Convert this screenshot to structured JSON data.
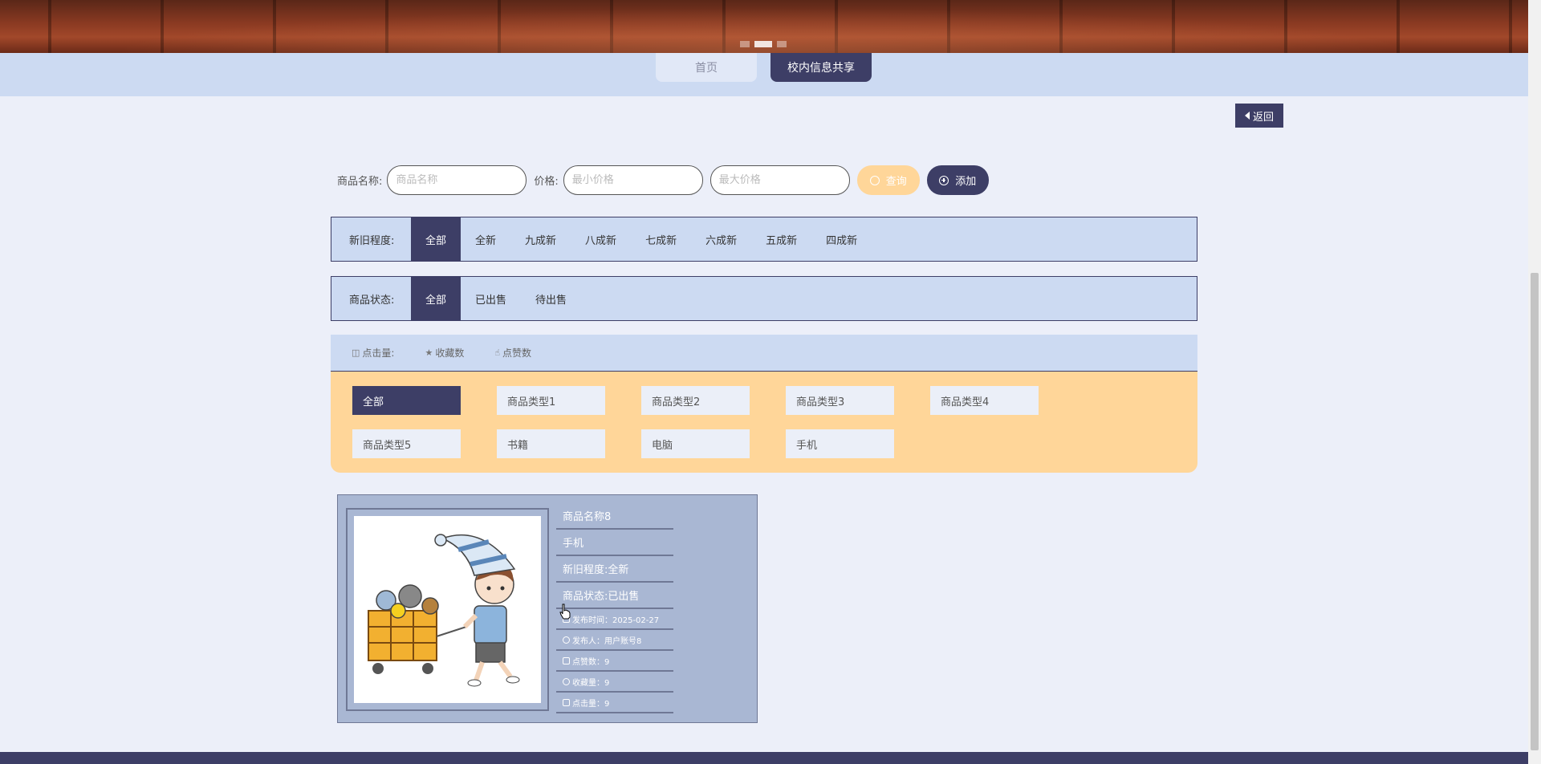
{
  "nav": {
    "home": "首页",
    "share": "校内信息共享"
  },
  "back_label": "返回",
  "search": {
    "name_label": "商品名称:",
    "name_placeholder": "商品名称",
    "price_label": "价格:",
    "min_placeholder": "最小价格",
    "max_placeholder": "最大价格",
    "query_label": "查询",
    "add_label": "添加"
  },
  "condition_filter": {
    "label": "新旧程度:",
    "options": [
      "全部",
      "全新",
      "九成新",
      "八成新",
      "七成新",
      "六成新",
      "五成新",
      "四成新"
    ],
    "selected": "全部"
  },
  "status_filter": {
    "label": "商品状态:",
    "options": [
      "全部",
      "已出售",
      "待出售"
    ],
    "selected": "全部"
  },
  "sort": {
    "clicks": "点击量:",
    "favorites": "收藏数",
    "likes": "点赞数"
  },
  "categories": {
    "items": [
      "全部",
      "商品类型1",
      "商品类型2",
      "商品类型3",
      "商品类型4",
      "商品类型5",
      "书籍",
      "电脑",
      "手机"
    ],
    "selected": "全部"
  },
  "product": {
    "name": "商品名称8",
    "category": "手机",
    "condition": "新旧程度:全新",
    "status": "商品状态:已出售",
    "publish_time": "发布时间：2025-02-27",
    "publisher": "发布人：用户账号8",
    "likes": "点赞数：9",
    "favorites": "收藏量：9",
    "clicks": "点击量：9"
  },
  "colors": {
    "primary": "#3d3e66",
    "accent": "#ffd699",
    "panel": "#ccdaf2",
    "card": "#a9b7d3",
    "background": "#eceff9"
  }
}
